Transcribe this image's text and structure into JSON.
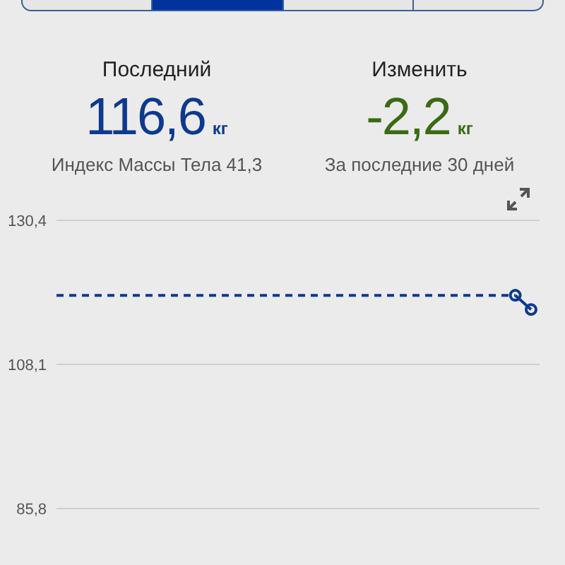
{
  "tabs": [
    {
      "selected": false
    },
    {
      "selected": true
    },
    {
      "selected": false
    },
    {
      "selected": false
    }
  ],
  "summary": [
    {
      "kind": "latest",
      "title": "Последний",
      "value": "116,6",
      "unit": "кг",
      "caption": "Индекс Массы Тела 41,3"
    },
    {
      "kind": "change",
      "title": "Изменить",
      "value": "-2,2",
      "unit": "кг",
      "caption": "За последние 30 дней"
    }
  ],
  "chart": {
    "chart_data": {
      "type": "line",
      "line_style": "dashed",
      "categories": [
        null,
        null,
        null,
        null,
        null,
        null,
        null,
        null,
        null,
        null,
        null,
        null,
        null,
        null,
        null,
        null,
        null,
        null,
        null,
        null,
        null,
        null,
        null,
        null,
        null,
        null,
        null,
        null,
        null,
        null,
        null
      ],
      "ylim": [
        85.8,
        130.4
      ],
      "yticks": [
        {
          "value": 130.4,
          "label": "130,4"
        },
        {
          "value": 108.1,
          "label": "108,1"
        },
        {
          "value": 85.8,
          "label": "85,8"
        }
      ],
      "values": [
        118.8,
        118.8,
        118.8,
        118.8,
        118.8,
        118.8,
        118.8,
        118.8,
        118.8,
        118.8,
        118.8,
        118.8,
        118.8,
        118.8,
        118.8,
        118.8,
        118.8,
        118.8,
        118.8,
        118.8,
        118.8,
        118.8,
        118.8,
        118.8,
        118.8,
        118.8,
        118.8,
        118.8,
        118.8,
        118.8,
        116.6
      ]
    }
  }
}
